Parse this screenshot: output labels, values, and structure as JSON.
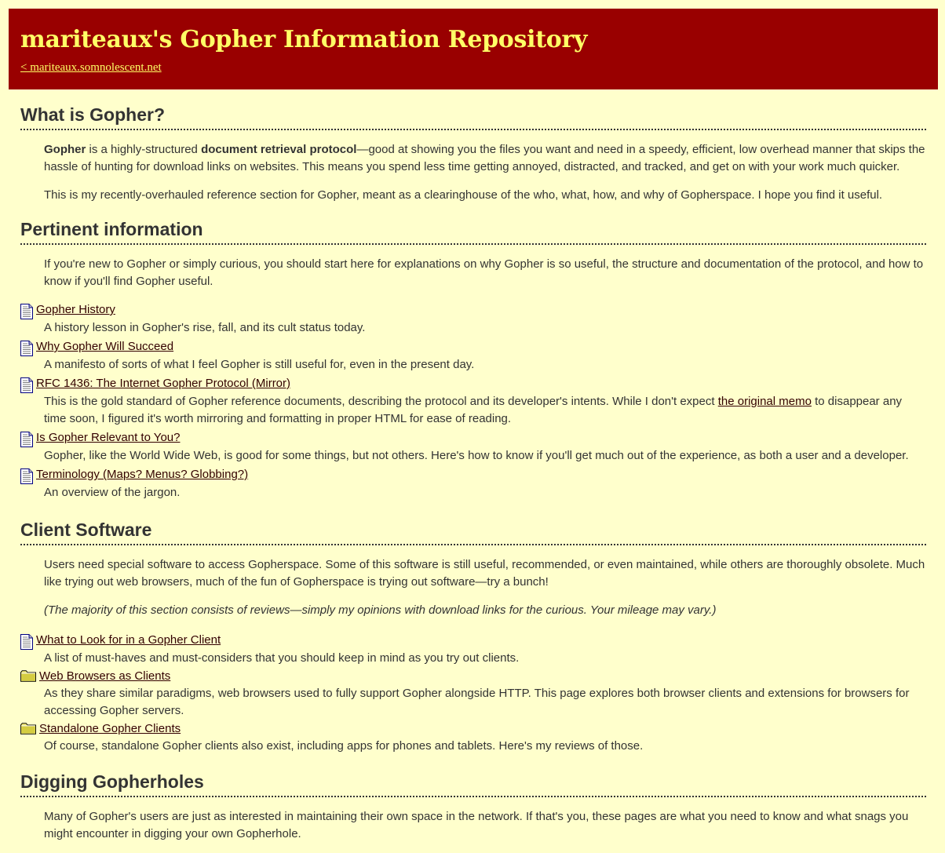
{
  "header": {
    "title": "mariteaux's Gopher Information Repository",
    "back_link": "< mariteaux.somnolescent.net"
  },
  "colors": {
    "background": "#ffffcc",
    "header_bg": "#990000",
    "header_text": "#ffff66",
    "body_text": "#333333",
    "link": "#330000"
  },
  "sections": [
    {
      "heading": "What is Gopher?",
      "intro": {
        "p1_b1": "Gopher",
        "p1_t1": " is a highly-structured ",
        "p1_b2": "document retrieval protocol",
        "p1_t2": "—good at showing you the files you want and need in a speedy, efficient, low overhead manner that skips the hassle of hunting for download links on websites. This means you spend less time getting annoyed, distracted, and tracked, and get on with your work much quicker.",
        "p2": "This is my recently-overhauled reference section for Gopher, meant as a clearinghouse of the who, what, how, and why of Gopherspace. I hope you find it useful."
      }
    },
    {
      "heading": "Pertinent information",
      "intro": "If you're new to Gopher or simply curious, you should start here for explanations on why Gopher is so useful, the structure and documentation of the protocol, and how to know if you'll find Gopher useful.",
      "entries": [
        {
          "icon": "document-icon",
          "title": "Gopher History",
          "desc": "A history lesson in Gopher's rise, fall, and its cult status today."
        },
        {
          "icon": "document-icon",
          "title": "Why Gopher Will Succeed",
          "desc": "A manifesto of sorts of what I feel Gopher is still useful for, even in the present day."
        },
        {
          "icon": "document-icon",
          "title": "RFC 1436: The Internet Gopher Protocol (Mirror)",
          "desc_pre": "This is the gold standard of Gopher reference documents, describing the protocol and its developer's intents. While I don't expect ",
          "desc_link": "the original memo",
          "desc_post": " to disappear any time soon, I figured it's worth mirroring and formatting in proper HTML for ease of reading."
        },
        {
          "icon": "document-icon",
          "title": "Is Gopher Relevant to You?",
          "desc": "Gopher, like the World Wide Web, is good for some things, but not others. Here's how to know if you'll get much out of the experience, as both a user and a developer."
        },
        {
          "icon": "document-icon",
          "title": "Terminology (Maps? Menus? Globbing?)",
          "desc": "An overview of the jargon."
        }
      ]
    },
    {
      "heading": "Client Software",
      "intro": "Users need special software to access Gopherspace. Some of this software is still useful, recommended, or even maintained, while others are thoroughly obsolete. Much like trying out web browsers, much of the fun of Gopherspace is trying out software—try a bunch!",
      "note": "(The majority of this section consists of reviews—simply my opinions with download links for the curious. Your mileage may vary.)",
      "entries": [
        {
          "icon": "document-icon",
          "title": "What to Look for in a Gopher Client",
          "desc": "A list of must-haves and must-considers that you should keep in mind as you try out clients."
        },
        {
          "icon": "folder-icon",
          "title": "Web Browsers as Clients",
          "desc": "As they share similar paradigms, web browsers used to fully support Gopher alongside HTTP. This page explores both browser clients and extensions for browsers for accessing Gopher servers."
        },
        {
          "icon": "folder-icon",
          "title": "Standalone Gopher Clients",
          "desc": "Of course, standalone Gopher clients also exist, including apps for phones and tablets. Here's my reviews of those."
        }
      ]
    },
    {
      "heading": "Digging Gopherholes",
      "intro": "Many of Gopher's users are just as interested in maintaining their own space in the network. If that's you, these pages are what you need to know and what snags you might encounter in digging your own Gopherhole."
    }
  ]
}
